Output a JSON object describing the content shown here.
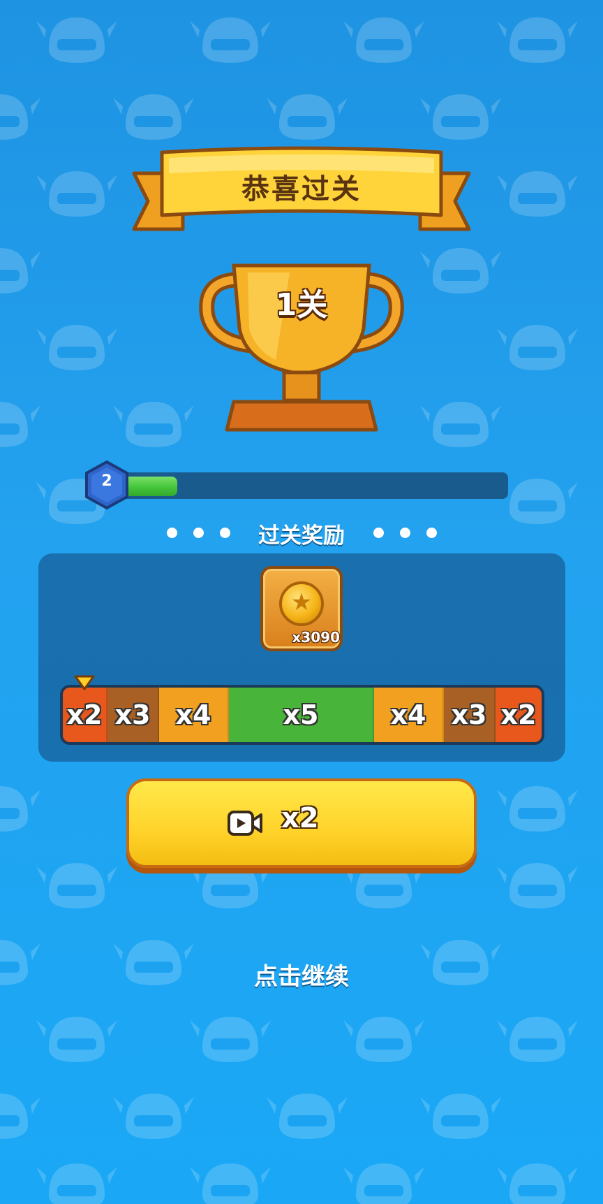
{
  "title": "恭喜过关",
  "trophy": {
    "label": "1关"
  },
  "level": {
    "badge": "2",
    "progress": 0.166
  },
  "reward_header": "过关奖励",
  "reward": {
    "icon": "coin-icon",
    "amount": "x3090"
  },
  "multipliers": [
    {
      "label": "x2",
      "color": "#e8581c"
    },
    {
      "label": "x3",
      "color": "#a96024"
    },
    {
      "label": "x4",
      "color": "#f1a020"
    },
    {
      "label": "x5",
      "color": "#49b43a"
    },
    {
      "label": "x4",
      "color": "#f1a020"
    },
    {
      "label": "x3",
      "color": "#a96024"
    },
    {
      "label": "x2",
      "color": "#e8581c"
    }
  ],
  "ad_button": {
    "icon": "video-ad-icon",
    "label": "x2"
  },
  "continue_text": "点击继续",
  "colors": {
    "accent": "#ffd32a",
    "background": "#1e93e2"
  }
}
